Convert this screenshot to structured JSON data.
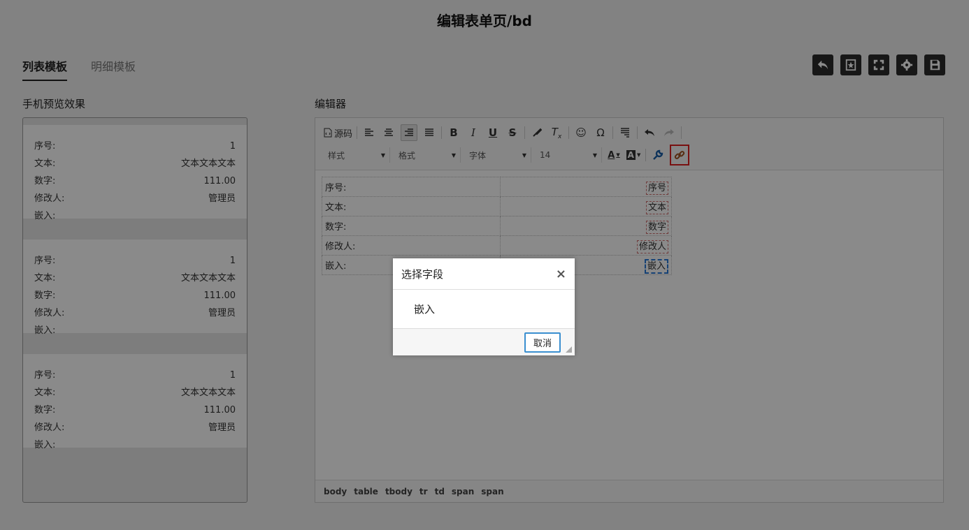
{
  "page": {
    "title": "编辑表单页/bd"
  },
  "tabs": [
    {
      "label": "列表模板",
      "active": true
    },
    {
      "label": "明细模板",
      "active": false
    }
  ],
  "top_buttons": [
    {
      "icon": "back-icon"
    },
    {
      "icon": "bookmark-star-icon"
    },
    {
      "icon": "fullscreen-icon"
    },
    {
      "icon": "gear-icon"
    },
    {
      "icon": "save-icon"
    }
  ],
  "preview": {
    "label": "手机预览效果",
    "cards": [
      {
        "rows": [
          {
            "k": "序号:",
            "v": "1"
          },
          {
            "k": "文本:",
            "v": "文本文本文本"
          },
          {
            "k": "数字:",
            "v": "111.00"
          },
          {
            "k": "修改人:",
            "v": "管理员"
          },
          {
            "k": "嵌入:",
            "v": ""
          }
        ]
      },
      {
        "rows": [
          {
            "k": "序号:",
            "v": "1"
          },
          {
            "k": "文本:",
            "v": "文本文本文本"
          },
          {
            "k": "数字:",
            "v": "111.00"
          },
          {
            "k": "修改人:",
            "v": "管理员"
          },
          {
            "k": "嵌入:",
            "v": ""
          }
        ]
      },
      {
        "rows": [
          {
            "k": "序号:",
            "v": "1"
          },
          {
            "k": "文本:",
            "v": "文本文本文本"
          },
          {
            "k": "数字:",
            "v": "111.00"
          },
          {
            "k": "修改人:",
            "v": "管理员"
          },
          {
            "k": "嵌入:",
            "v": ""
          }
        ]
      }
    ]
  },
  "editor": {
    "label": "编辑器",
    "toolbar": {
      "source_label": "源码",
      "dropdowns": [
        {
          "label": "样式"
        },
        {
          "label": "格式"
        },
        {
          "label": "字体"
        },
        {
          "label": "14"
        }
      ]
    },
    "table_rows": [
      {
        "k": "序号:",
        "v": "序号"
      },
      {
        "k": "文本:",
        "v": "文本"
      },
      {
        "k": "数字:",
        "v": "数字"
      },
      {
        "k": "修改人:",
        "v": "修改人"
      },
      {
        "k": "嵌入:",
        "v": "嵌入"
      }
    ],
    "status_path": [
      "body",
      "table",
      "tbody",
      "tr",
      "td",
      "span",
      "span"
    ]
  },
  "dialog": {
    "title": "选择字段",
    "close_glyph": "×",
    "item": "嵌入",
    "cancel_label": "取消"
  },
  "colors": {
    "accent_border": "#e02020",
    "button_bg": "#2b2b2b",
    "selection_blue": "#2a7ad8"
  }
}
